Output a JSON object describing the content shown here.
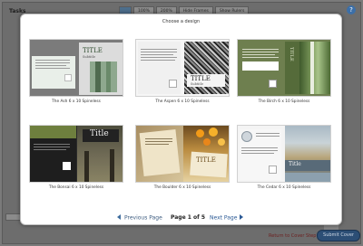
{
  "app": {
    "tasks_label": "Tasks",
    "toolbar": [
      "",
      "100%",
      "200%",
      "Hide Frames",
      "Show Rulers"
    ],
    "help_icon": "?",
    "return_link": "Return to Cover Step",
    "submit_button": "Submit Cover"
  },
  "modal": {
    "title": "Choose a design",
    "designs": [
      {
        "label": "The Ash 6 x 10 Spineless",
        "thumb_title": "TITLE",
        "thumb_subtitle": "Subtitle"
      },
      {
        "label": "The Aspen 6 x 10 Spineless",
        "thumb_title": "TITLE",
        "thumb_subtitle": "Subtitle"
      },
      {
        "label": "The Birch 6 x 10 Spineless",
        "thumb_title": "TITLE",
        "thumb_subtitle": ""
      },
      {
        "label": "The Bonsai 6 x 10 Spineless",
        "thumb_title": "Title",
        "thumb_subtitle": ""
      },
      {
        "label": "The Boulder 6 x 10 Spineless",
        "thumb_title": "TITLE",
        "thumb_subtitle": ""
      },
      {
        "label": "The Cedar 6 x 10 Spineless",
        "thumb_title": "Title",
        "thumb_subtitle": ""
      }
    ],
    "pager": {
      "previous": "Previous Page",
      "indicator": "Page 1 of 5",
      "next": "Next Page"
    }
  },
  "colors": {
    "accent_link": "#2b5a95",
    "submit_bg": "#2c4e75",
    "overlay_bg": "#6d6d6d"
  }
}
